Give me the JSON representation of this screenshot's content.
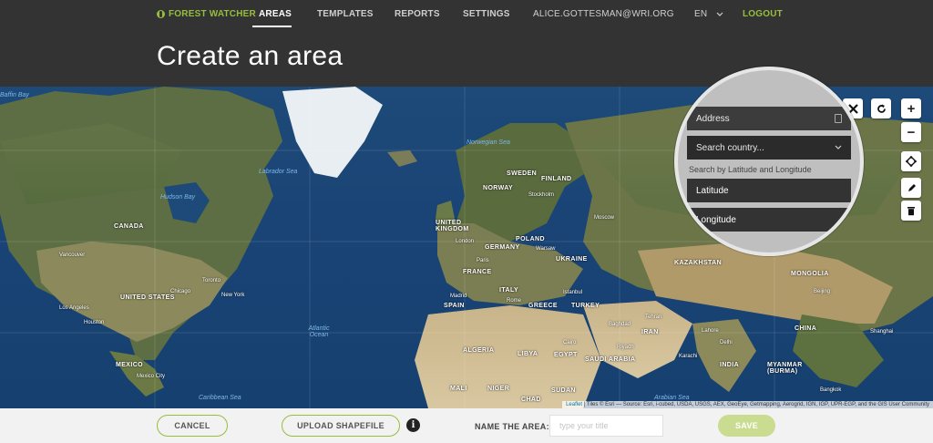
{
  "nav": {
    "brand": "FOREST WATCHER",
    "areas": "AREAS",
    "templates": "TEMPLATES",
    "reports": "REPORTS",
    "settings": "SETTINGS",
    "user": "ALICE.GOTTESMAN@WRI.ORG",
    "language": "EN",
    "logout": "LOGOUT"
  },
  "page": {
    "title": "Create an area"
  },
  "search": {
    "address_placeholder": "Address",
    "country_placeholder": "Search country...",
    "latlng_hint": "Search by Latitude and Longitude",
    "latitude_placeholder": "Latitude",
    "longitude_placeholder": "Longitude"
  },
  "map_controls": {
    "zoom_in": "+",
    "zoom_out": "−"
  },
  "map_labels": {
    "countries": [
      "CANADA",
      "UNITED STATES",
      "MEXICO",
      "SWEDEN",
      "FINLAND",
      "NORWAY",
      "UNITED KINGDOM",
      "POLAND",
      "GERMANY",
      "UKRAINE",
      "FRANCE",
      "ITALY",
      "SPAIN",
      "GREECE",
      "TURKEY",
      "KAZAKHSTAN",
      "MONGOLIA",
      "CHINA",
      "IRAN",
      "INDIA",
      "MYANMAR (BURMA)",
      "SAUDI ARABIA",
      "EGYPT",
      "LIBYA",
      "ALGERIA",
      "MALI",
      "NIGER",
      "SUDAN",
      "CHAD"
    ],
    "cities": [
      "Vancouver",
      "Toronto",
      "Chicago",
      "New York",
      "Los Angeles",
      "Houston",
      "Mexico City",
      "London",
      "Paris",
      "Madrid",
      "Rome",
      "Warsaw",
      "Stockholm",
      "Moscow",
      "Istanbul",
      "Tehran",
      "Baghdad",
      "Cairo",
      "Riyadh",
      "Beijing",
      "Shanghai",
      "Delhi",
      "Bangkok",
      "Karachi",
      "Lahore"
    ],
    "oceans": [
      "Atlantic Ocean",
      "Hudson Bay",
      "Norwegian Sea",
      "Caribbean Sea",
      "Arabian Sea",
      "Labrador Sea",
      "Baffin Bay"
    ]
  },
  "attribution": {
    "leaflet": "Leaflet",
    "text": "| Tiles © Esri — Source: Esri, i-cubed, USDA, USGS, AEX, GeoEye, Getmapping, Aerogrid, IGN, IGP, UPR-EGP, and the GIS User Community"
  },
  "footer": {
    "cancel": "CANCEL",
    "upload": "UPLOAD SHAPEFILE",
    "info": "i",
    "name_label": "NAME THE AREA:",
    "name_placeholder": "type your title",
    "save": "SAVE"
  }
}
